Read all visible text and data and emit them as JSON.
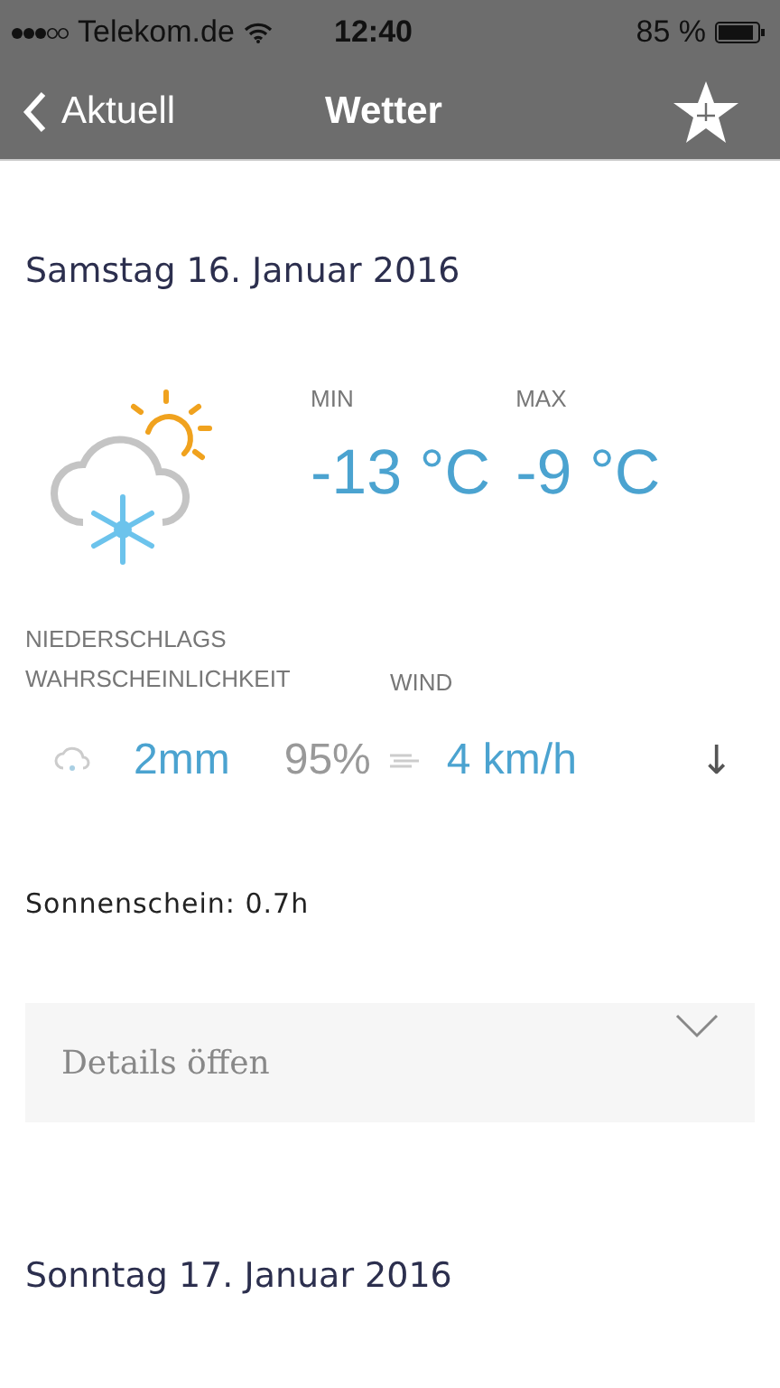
{
  "status_bar": {
    "carrier": "Telekom.de",
    "time": "12:40",
    "battery": "85 %"
  },
  "nav": {
    "back": "Aktuell",
    "title": "Wetter"
  },
  "days": [
    {
      "date": "Samstag 16. Januar 2016",
      "min_label": "MIN",
      "max_label": "MAX",
      "min": "-13 °C",
      "max": "-9 °C",
      "precip_label": "NIEDERSCHLAGS WAHRSCHEINLICHKEIT",
      "wind_label": "WIND",
      "precip_amount": "2mm",
      "precip_prob": "95%",
      "wind_speed": "4 km/h",
      "wind_direction": "↓",
      "sunshine": "Sonnenschein: 0.7h",
      "details": "Details öffen",
      "expanded": false
    },
    {
      "date": "Sonntag 17. Januar 2016"
    }
  ]
}
